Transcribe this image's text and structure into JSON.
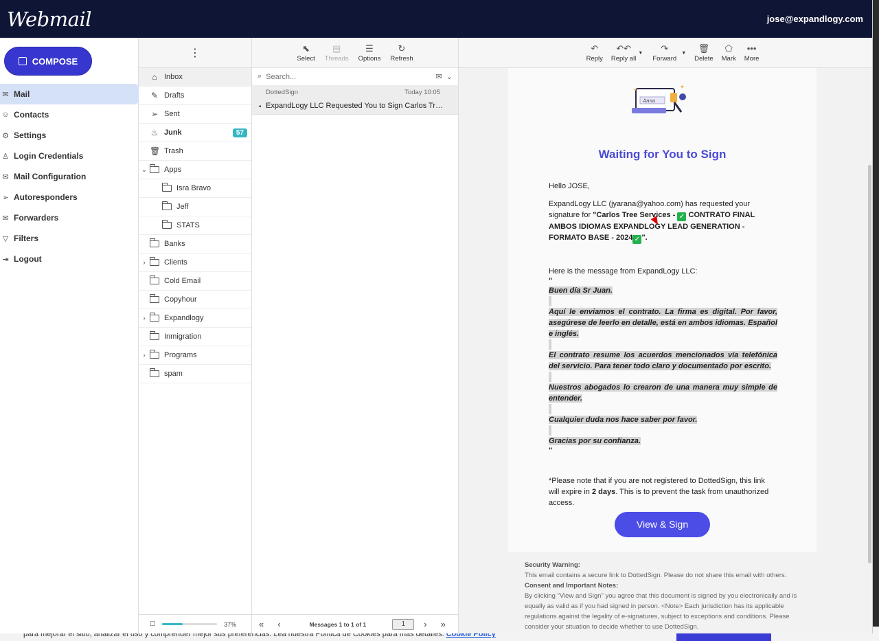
{
  "app": {
    "logo": "Webmail",
    "user_email": "jose@expandlogy.com"
  },
  "compose": {
    "label": "COMPOSE"
  },
  "nav": [
    {
      "label": "Mail",
      "icon": "mail-icon"
    },
    {
      "label": "Contacts",
      "icon": "contacts-icon"
    },
    {
      "label": "Settings",
      "icon": "gear-icon"
    },
    {
      "label": "Login Credentials",
      "icon": "user-icon"
    },
    {
      "label": "Mail Configuration",
      "icon": "mail-config-icon"
    },
    {
      "label": "Autoresponders",
      "icon": "send-icon"
    },
    {
      "label": "Forwarders",
      "icon": "forward-icon"
    },
    {
      "label": "Filters",
      "icon": "filter-icon"
    },
    {
      "label": "Logout",
      "icon": "logout-icon"
    }
  ],
  "folders": {
    "menu_icon": "⋮",
    "items": [
      {
        "label": "Inbox",
        "icon": "inbox-icon"
      },
      {
        "label": "Drafts",
        "icon": "pencil-icon"
      },
      {
        "label": "Sent",
        "icon": "send-icon"
      },
      {
        "label": "Junk",
        "icon": "fire-icon",
        "badge": "57"
      },
      {
        "label": "Trash",
        "icon": "trash-icon"
      },
      {
        "label": "Apps",
        "icon": "folder-icon"
      },
      {
        "label": "Isra Bravo",
        "icon": "folder-icon"
      },
      {
        "label": "Jeff",
        "icon": "folder-icon"
      },
      {
        "label": "STATS",
        "icon": "folder-icon"
      },
      {
        "label": "Banks",
        "icon": "folder-icon"
      },
      {
        "label": "Clients",
        "icon": "folder-icon"
      },
      {
        "label": "Cold Email",
        "icon": "folder-icon"
      },
      {
        "label": "Copyhour",
        "icon": "folder-icon"
      },
      {
        "label": "Expandlogy",
        "icon": "folder-icon"
      },
      {
        "label": "Inmigration",
        "icon": "folder-icon"
      },
      {
        "label": "Programs",
        "icon": "folder-icon"
      },
      {
        "label": "spam",
        "icon": "folder-icon"
      }
    ],
    "quota_percent": "37%",
    "quota_fraction": 0.37
  },
  "list_toolbar": {
    "select": "Select",
    "threads": "Threads",
    "options": "Options",
    "refresh": "Refresh"
  },
  "search": {
    "placeholder": "Search..."
  },
  "messages": [
    {
      "from": "DottedSign",
      "date": "Today 10:05",
      "subject": "ExpandLogy LLC Requested You to Sign Carlos Tree Services - ✅ CONTRATO FINAL AMBOS IDIOMAS"
    }
  ],
  "list_footer": {
    "count": "Messages 1 to 1 of 1",
    "page": "1"
  },
  "reader_toolbar": {
    "reply": "Reply",
    "reply_all": "Reply all",
    "forward": "Forward",
    "delete": "Delete",
    "mark": "Mark",
    "more": "More"
  },
  "email": {
    "illustration_text": "Anna",
    "heading": "Waiting for You to Sign",
    "greeting": "Hello JOSE,",
    "request_prefix": "ExpandLogy LLC (jyarana@yahoo.com) has requested your signature for ",
    "doc_title_1": "\"Carlos Tree Services - ",
    "doc_title_2": " CONTRATO FINAL AMBOS IDIOMAS EXPANDLOGY LEAD GENERATION - FORMATO BASE - 2024",
    "doc_title_end": "\".",
    "message_intro": "Here is the message from ExpandLogy LLC:",
    "quote_mark_open": "\"",
    "quote_lines": [
      "Buen día Sr Juan.",
      "Aquí le enviamos el contrato. La firma es digital. Por favor, asegúrese de leerlo en detalle, está en ambos idiomas. Español e inglés.",
      "El contrato resume los acuerdos mencionados vía telefónica del servicio. Para tener todo claro y documentado por escrito.",
      "Nuestros abogados lo crearon de una manera muy simple de entender.",
      "Cualquier duda nos hace saber por favor.",
      "Gracias por su confianza."
    ],
    "quote_mark_close": "\"",
    "note_1": "*Please note that if you are not registered to DottedSign, this link will expire in ",
    "note_days": "2 days",
    "note_2": ". This is to prevent the task from unauthorized access.",
    "button": "View & Sign",
    "security_title": "Security Warning:",
    "security_text": "This email contains a secure link to DottedSign. Please do not share this email with others.",
    "consent_title": "Consent and Important Notes:",
    "consent_text": "By clicking \"View and Sign\" you agree that this document is signed by you electronically and is equally as valid as if you had signed in person. <Note> Each jurisdiction has its applicable regulations against the legality of e-signatures, subject to exceptions and conditions. Please consider your situation to decide whether to use DottedSign."
  },
  "cookie_bar": {
    "text": "para mejorar el sitio, analizar el uso y comprender mejor sus preferencias. Lea nuestra Política de Cookies para más detalles.",
    "link": "Cookie Policy"
  },
  "colors": {
    "topbar": "#0f1535",
    "compose": "#3737d0",
    "accent": "#4a4ad4",
    "badge": "#35b6c5"
  }
}
